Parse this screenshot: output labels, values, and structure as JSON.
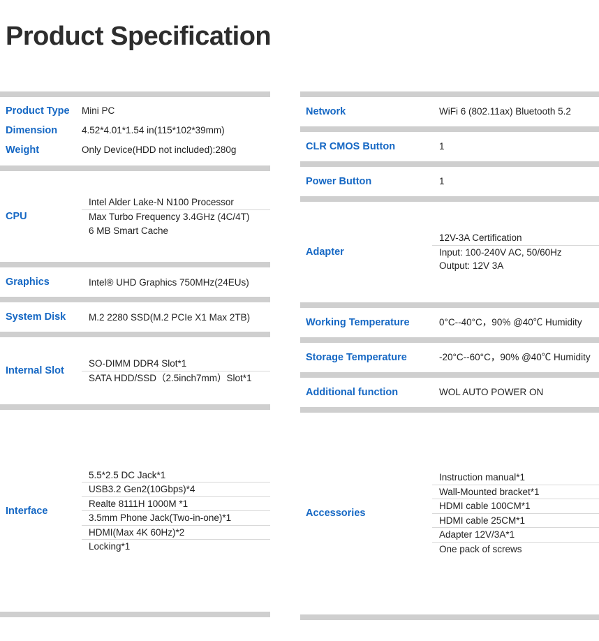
{
  "title": "Product Specification",
  "colors": {
    "label_blue": "#1668c4",
    "separator_gray": "#cfcfcf",
    "divider_gray": "#d8d8d8",
    "text": "#222222"
  },
  "left_column": [
    {
      "type": "simple",
      "rows": [
        {
          "label": "Product Type",
          "value": "Mini PC"
        },
        {
          "label": "Dimension",
          "value": "4.52*4.01*1.54 in(115*102*39mm)"
        },
        {
          "label": "Weight",
          "value": "Only Device(HDD not included):280g"
        }
      ]
    },
    {
      "type": "block",
      "label": "CPU",
      "height_class": "h-cpu",
      "values": [
        [
          "Intel Alder Lake-N N100 Processor"
        ],
        [
          "Max Turbo Frequency 3.4GHz  (4C/4T)",
          "6 MB Smart Cache"
        ]
      ]
    },
    {
      "type": "block",
      "label": "Graphics",
      "height_class": "h-one",
      "values": [
        [
          "Intel® UHD Graphics 750MHz(24EUs)"
        ]
      ]
    },
    {
      "type": "block",
      "label": "System Disk",
      "height_class": "h-one",
      "values": [
        [
          "M.2  2280 SSD(M.2 PCIe X1 Max 2TB)"
        ]
      ]
    },
    {
      "type": "block",
      "label": "Internal Slot",
      "height_class": "h-two",
      "values": [
        [
          "SO-DIMM DDR4 Slot*1"
        ],
        [
          "SATA HDD/SSD（2.5inch7mm）Slot*1"
        ]
      ]
    },
    {
      "type": "block",
      "label": "Interface",
      "height_class": "h-iface",
      "last": true,
      "values": [
        [
          "5.5*2.5 DC Jack*1"
        ],
        [
          "USB3.2 Gen2(10Gbps)*4"
        ],
        [
          "Realte 8111H 1000M *1"
        ],
        [
          "3.5mm Phone Jack(Two-in-one)*1"
        ],
        [
          "HDMI(Max 4K 60Hz)*2"
        ],
        [
          "Locking*1"
        ]
      ]
    }
  ],
  "right_column": [
    {
      "type": "block",
      "label": "Network",
      "height_class": "h-one",
      "values": [
        [
          "WiFi 6 (802.11ax)  Bluetooth 5.2"
        ]
      ]
    },
    {
      "type": "block",
      "label": "CLR CMOS Button",
      "height_class": "h-one",
      "values": [
        [
          "1"
        ]
      ]
    },
    {
      "type": "block",
      "label": "Power Button",
      "height_class": "h-one",
      "values": [
        [
          "1"
        ]
      ]
    },
    {
      "type": "block",
      "label": "Adapter",
      "height_class": "h-adapt",
      "values": [
        [
          "12V-3A  Certification"
        ],
        [
          "Input: 100-240V AC, 50/60Hz",
          "Output: 12V 3A"
        ]
      ]
    },
    {
      "type": "block",
      "label": "Working Temperature",
      "height_class": "h-one",
      "values": [
        [
          "0°C--40°C，90% @40℃ Humidity"
        ]
      ]
    },
    {
      "type": "block",
      "label": "Storage Temperature",
      "height_class": "h-one",
      "values": [
        [
          "-20°C--60°C，90% @40℃ Humidity"
        ]
      ]
    },
    {
      "type": "block",
      "label": "Additional function",
      "height_class": "h-one",
      "values": [
        [
          "WOL   AUTO POWER ON"
        ]
      ]
    },
    {
      "type": "block",
      "label": "Accessories",
      "height_class": "h-acc",
      "last": true,
      "values": [
        [
          "Instruction manual*1"
        ],
        [
          "Wall-Mounted bracket*1"
        ],
        [
          "HDMI cable 100CM*1"
        ],
        [
          "HDMI cable 25CM*1"
        ],
        [
          "Adapter 12V/3A*1"
        ],
        [
          "One pack of screws"
        ]
      ]
    }
  ]
}
